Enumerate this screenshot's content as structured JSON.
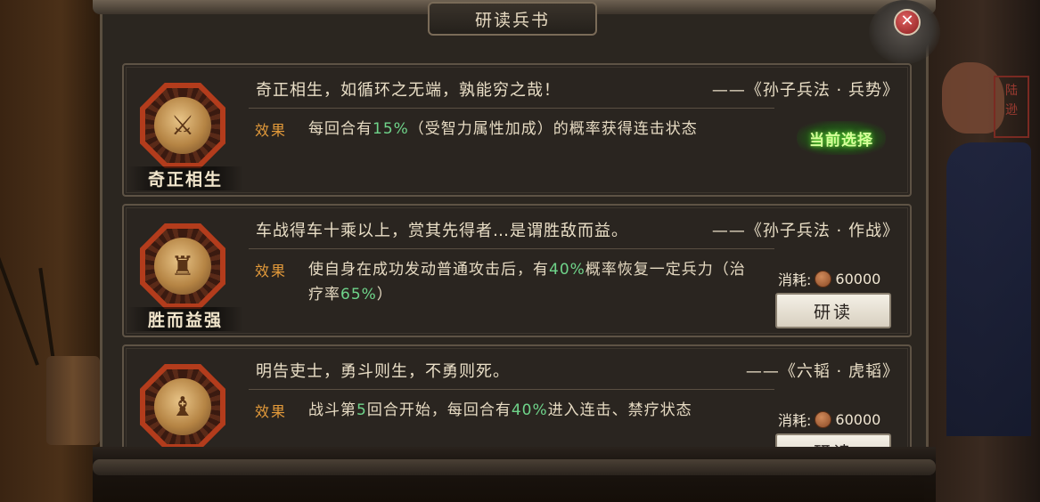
{
  "window": {
    "title": "研读兵书"
  },
  "colors": {
    "highlight": "#6fd48a",
    "effect_label": "#e39a3a",
    "selected_glow": "#6cff3a"
  },
  "background": {
    "seal_text": "陆\n逊"
  },
  "close_button": {
    "icon": "close-icon"
  },
  "cards": [
    {
      "name": "奇正相生",
      "icon": "sword-icon",
      "quote": "奇正相生，如循环之无端，孰能穷之哉！",
      "source": "——《孙子兵法 · 兵势》",
      "effect_label": "效果",
      "effect_parts": [
        "每回合有",
        "15%",
        "（受智力属性加成）的概率获得连击状态"
      ],
      "status": "当前选择"
    },
    {
      "name": "胜而益强",
      "icon": "soldier-icon",
      "quote": "车战得车十乘以上，赏其先得者…是谓胜敌而益。",
      "source": "——《孙子兵法 · 作战》",
      "effect_label": "效果",
      "effect_parts": [
        "使自身在成功发动普通攻击后，有",
        "40%",
        "概率恢复一定兵力（治疗率",
        "65%",
        "）"
      ],
      "cost_label": "消耗:",
      "cost_value": "60000",
      "button": "研读"
    },
    {
      "name": "",
      "icon": "official-icon",
      "quote": "明告吏士，勇斗则生，不勇则死。",
      "source": "——《六韬 · 虎韬》",
      "effect_label": "效果",
      "effect_parts": [
        "战斗第",
        "5",
        "回合开始，每回合有",
        "40%",
        "进入连击、禁疗状态"
      ],
      "cost_label": "消耗:",
      "cost_value": "60000",
      "button": "研读"
    }
  ]
}
